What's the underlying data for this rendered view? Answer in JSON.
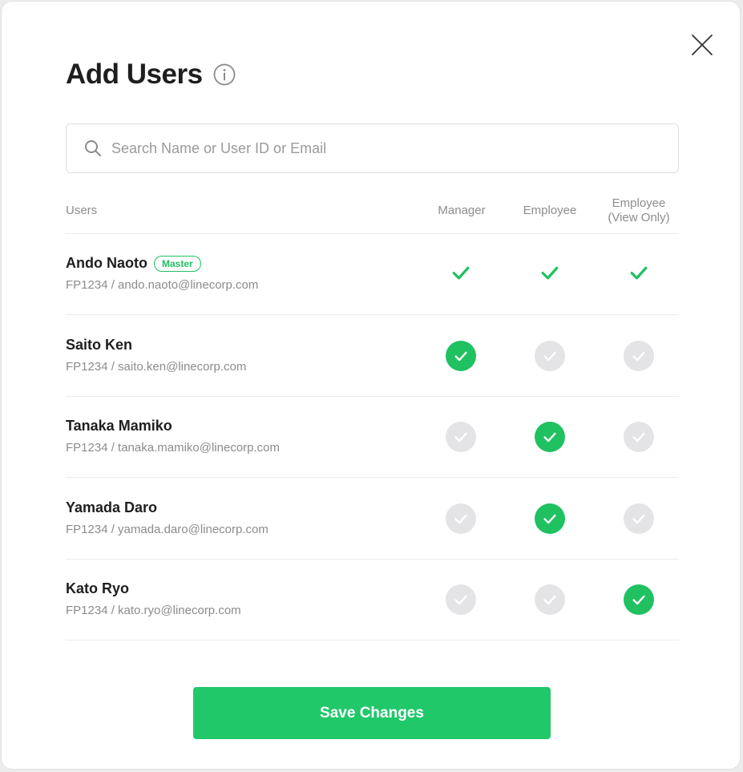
{
  "dialog": {
    "title": "Add Users",
    "save_label": "Save Changes"
  },
  "search": {
    "placeholder": "Search Name or User ID or Email",
    "value": ""
  },
  "columns": {
    "users": "Users",
    "manager": "Manager",
    "employee": "Employee",
    "employee_view_only": "Employee\n(View Only)"
  },
  "colors": {
    "accent": "#20c161",
    "inactive": "#e4e4e6"
  },
  "users": [
    {
      "name": "Ando Naoto",
      "badge": "Master",
      "id_email": "FP1234 / ando.naoto@linecorp.com",
      "roles": {
        "manager": "check",
        "employee": "check",
        "employee_view_only": "check"
      }
    },
    {
      "name": "Saito Ken",
      "id_email": "FP1234 / saito.ken@linecorp.com",
      "roles": {
        "manager": "on",
        "employee": "off",
        "employee_view_only": "off"
      }
    },
    {
      "name": "Tanaka Mamiko",
      "id_email": "FP1234 / tanaka.mamiko@linecorp.com",
      "roles": {
        "manager": "off",
        "employee": "on",
        "employee_view_only": "off"
      }
    },
    {
      "name": "Yamada Daro",
      "id_email": "FP1234 / yamada.daro@linecorp.com",
      "roles": {
        "manager": "off",
        "employee": "on",
        "employee_view_only": "off"
      }
    },
    {
      "name": "Kato Ryo",
      "id_email": "FP1234 / kato.ryo@linecorp.com",
      "roles": {
        "manager": "off",
        "employee": "off",
        "employee_view_only": "on"
      }
    }
  ]
}
